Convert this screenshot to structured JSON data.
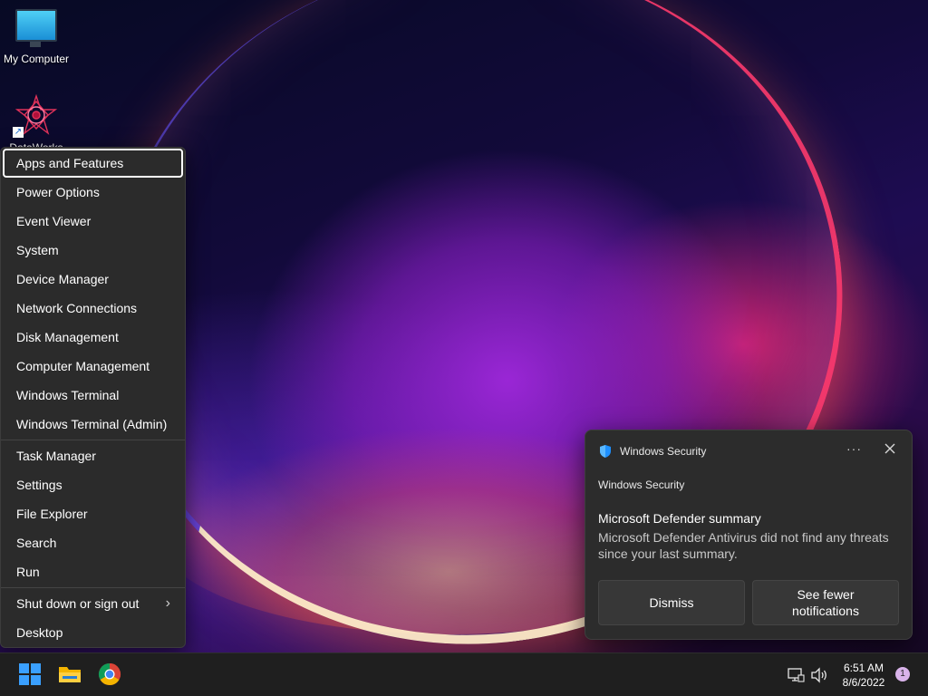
{
  "desktop": {
    "icons": [
      {
        "label": "My Computer",
        "icon": "monitor-icon"
      },
      {
        "label": "DataWorks",
        "icon": "star-logo-icon"
      }
    ]
  },
  "winx_menu": {
    "items": [
      {
        "label": "Apps and Features",
        "focused": true
      },
      {
        "label": "Power Options"
      },
      {
        "label": "Event Viewer"
      },
      {
        "label": "System"
      },
      {
        "label": "Device Manager"
      },
      {
        "label": "Network Connections"
      },
      {
        "label": "Disk Management"
      },
      {
        "label": "Computer Management"
      },
      {
        "label": "Windows Terminal"
      },
      {
        "label": "Windows Terminal (Admin)"
      },
      {
        "label": "Task Manager"
      },
      {
        "label": "Settings"
      },
      {
        "label": "File Explorer"
      },
      {
        "label": "Search"
      },
      {
        "label": "Run"
      },
      {
        "label": "Shut down or sign out",
        "submenu": true
      },
      {
        "label": "Desktop"
      }
    ],
    "chevron": "›"
  },
  "toast": {
    "header": "Windows Security",
    "more": "···",
    "app_label": "Windows Security",
    "title": "Microsoft Defender summary",
    "body": "Microsoft Defender Antivirus did not find any threats since your last summary.",
    "dismiss_label": "Dismiss",
    "fewer_label_1": "See fewer",
    "fewer_label_2": "notifications",
    "accent": "#1e90ff"
  },
  "taskbar": {
    "time": "6:51 AM",
    "date": "8/6/2022",
    "notification_count": "1",
    "apps": [
      "windows-start-icon",
      "file-explorer-icon",
      "chrome-icon"
    ],
    "tray": [
      "network-icon",
      "volume-icon"
    ]
  }
}
